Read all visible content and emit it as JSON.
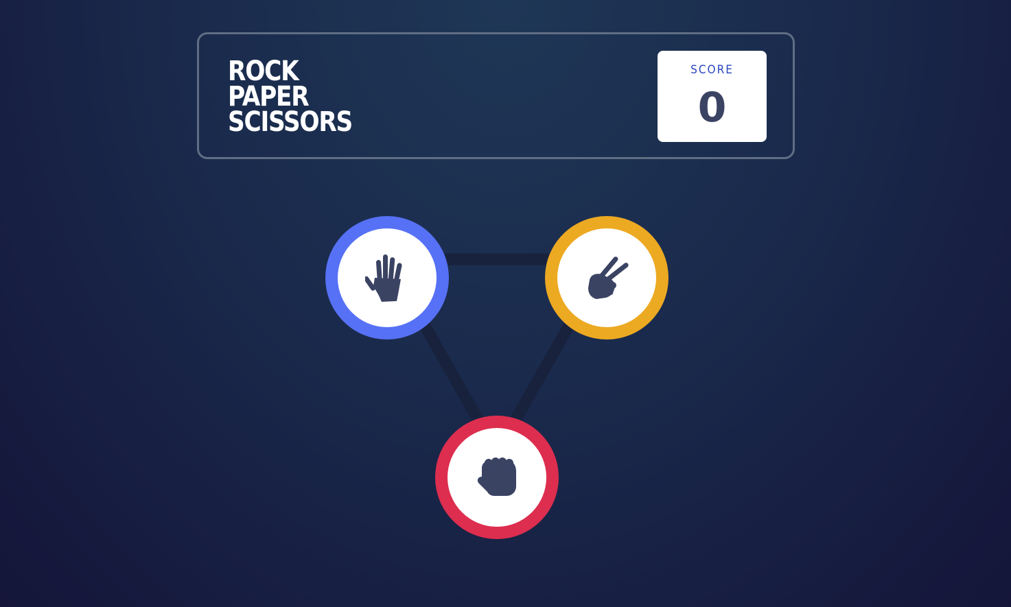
{
  "header": {
    "title_lines": [
      "ROCK",
      "PAPER",
      "SCISSORS"
    ],
    "score_label": "SCORE",
    "score_value": "0"
  },
  "choices": [
    {
      "id": "paper",
      "icon": "paper-hand-icon",
      "color": "#5671f5"
    },
    {
      "id": "scissors",
      "icon": "scissors-hand-icon",
      "color": "#eca922"
    },
    {
      "id": "rock",
      "icon": "rock-fist-icon",
      "color": "#dd2e4f"
    }
  ],
  "colors": {
    "background_top": "#1f3756",
    "background_bottom": "#141539",
    "triangle": "#18223d",
    "header_border": "#606e85",
    "score_label": "#2a46c0",
    "score_value": "#3b4363",
    "icon": "#3b4363"
  }
}
